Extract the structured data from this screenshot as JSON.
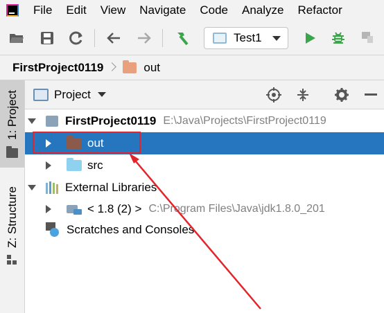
{
  "menu": {
    "items": [
      "File",
      "Edit",
      "View",
      "Navigate",
      "Code",
      "Analyze",
      "Refactor"
    ]
  },
  "toolbar": {
    "icons": [
      "open-folder-icon",
      "save-icon",
      "sync-icon",
      "back-icon",
      "forward-icon",
      "build-hammer-icon",
      "run-icon",
      "debug-icon",
      "coverage-icon"
    ],
    "run_config_label": "Test1"
  },
  "breadcrumb": {
    "project": "FirstProject0119",
    "folder": "out"
  },
  "left_strip": {
    "tab_project": "1: Project",
    "tab_structure": "Z: Structure"
  },
  "panel": {
    "title": "Project"
  },
  "tree": {
    "root_label": "FirstProject0119",
    "root_path": "E:\\Java\\Projects\\FirstProject0119",
    "out_label": "out",
    "src_label": "src",
    "ext_libs_label": "External Libraries",
    "jdk_label": "< 1.8 (2) >",
    "jdk_path": "C:\\Program Files\\Java\\jdk1.8.0_201",
    "scratches_label": "Scratches and Consoles"
  },
  "colors": {
    "selection": "#2675bf",
    "annotation": "#e3242b",
    "out_folder": "#8b5a4a",
    "src_folder": "#8fd2f0",
    "run_green": "#3aa54a"
  }
}
